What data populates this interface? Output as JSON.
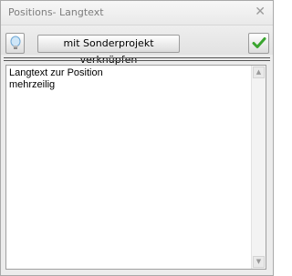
{
  "window": {
    "title": "Positions- Langtext",
    "close_icon": "close-icon"
  },
  "toolbar": {
    "hint_icon": "lightbulb-icon",
    "link_button_label": "mit Sonderprojekt verknüpfen",
    "confirm_icon": "checkmark-icon"
  },
  "editor": {
    "text": "Langtext zur Position\nmehrzeilig"
  },
  "colors": {
    "confirm_green": "#3aa52f",
    "bulb_blue": "#8ec3e8"
  }
}
